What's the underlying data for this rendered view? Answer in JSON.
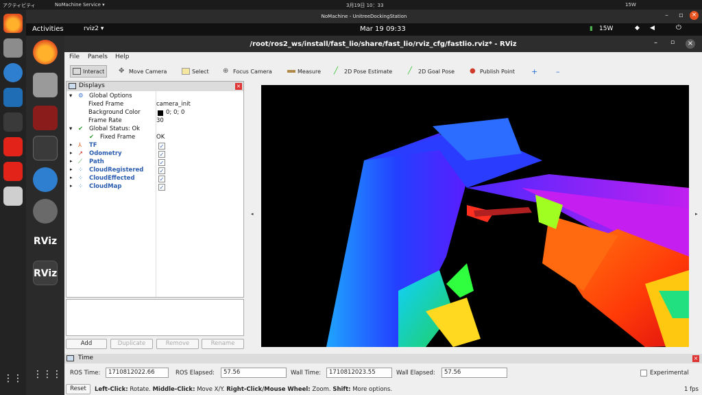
{
  "outer_bar": {
    "activities": "アクティビティ",
    "app": "NoMachine Service ▾",
    "clock": "3月19日 10：33",
    "power": "15W"
  },
  "nomachine_title": "NoMachine - UnitreeDockingStation",
  "inner_top": {
    "activities": "Activities",
    "app": "rviz2 ▾",
    "clock": "Mar 19  09:33",
    "power": "15W"
  },
  "rviz": {
    "title": "/root/ros2_ws/install/fast_lio/share/fast_lio/rviz_cfg/fastlio.rviz* - RViz",
    "menus": [
      "File",
      "Panels",
      "Help"
    ],
    "tools": [
      "Interact",
      "Move Camera",
      "Select",
      "Focus Camera",
      "Measure",
      "2D Pose Estimate",
      "2D Goal Pose",
      "Publish Point"
    ],
    "displays": {
      "title": "Displays",
      "global_options": "Global Options",
      "fixed_frame_label": "Fixed Frame",
      "fixed_frame_value": "camera_init",
      "bg_label": "Background Color",
      "bg_value": "0; 0; 0",
      "rate_label": "Frame Rate",
      "rate_value": "30",
      "global_status": "Global Status: Ok",
      "status_ff_label": "Fixed Frame",
      "status_ff_value": "OK",
      "items": [
        "TF",
        "Odometry",
        "Path",
        "CloudRegistered",
        "CloudEffected",
        "CloudMap"
      ],
      "checked": "✓"
    },
    "buttons": [
      "Add",
      "Duplicate",
      "Remove",
      "Rename"
    ],
    "time": {
      "title": "Time",
      "ros_time_label": "ROS Time:",
      "ros_time": "1710812022.66",
      "ros_elapsed_label": "ROS Elapsed:",
      "ros_elapsed": "57.56",
      "wall_time_label": "Wall Time:",
      "wall_time": "1710812023.55",
      "wall_elapsed_label": "Wall Elapsed:",
      "wall_elapsed": "57.56",
      "experimental": "Experimental"
    },
    "status": {
      "reset": "Reset",
      "k1": "Left-Click:",
      "v1": "Rotate.",
      "k2": "Middle-Click:",
      "v2": "Move X/Y.",
      "k3": "Right-Click/Mouse Wheel:",
      "v3": "Zoom.",
      "k4": "Shift:",
      "v4": "More options.",
      "fps": "1 fps"
    }
  }
}
